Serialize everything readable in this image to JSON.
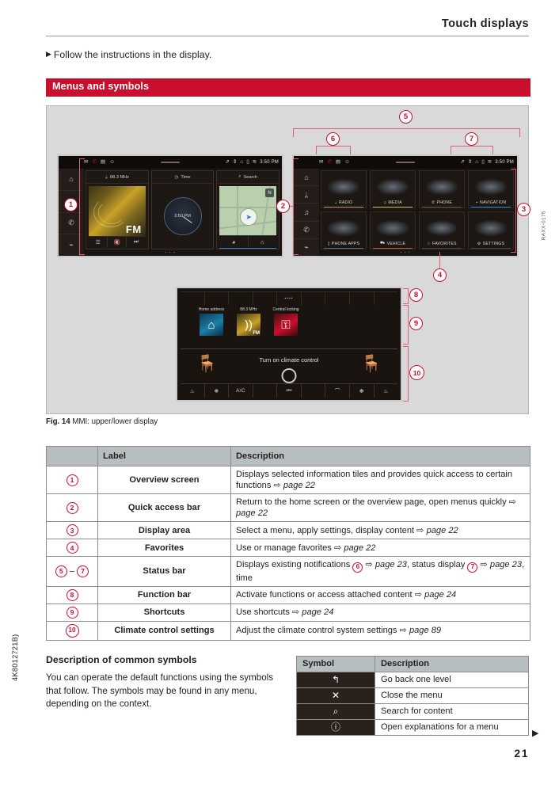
{
  "header": {
    "running_head": "Touch displays"
  },
  "intro": {
    "bullet": "Follow the instructions in the display."
  },
  "section": {
    "title": "Menus and symbols"
  },
  "figure": {
    "caption_label": "Fig. 14",
    "caption_text": "MMI: upper/lower display",
    "image_id": "RAXX-0175"
  },
  "mmi_upper_left": {
    "statusbar": {
      "icons_left": [
        "envelope-icon",
        "phone-icon",
        "card-icon",
        "smiley-icon"
      ],
      "icons_right": [
        "bluetooth-icon",
        "mute-icon",
        "lock-icon",
        "sim-icon",
        "wifi-icon"
      ],
      "time": "3:50 PM"
    },
    "quick_access": [
      "home-icon",
      "radio-icon",
      "phone-icon",
      "navigation-icon"
    ],
    "tiles": [
      {
        "header": "88.3 MHz",
        "header_icon": "radio-icon",
        "art_label": "FM",
        "controls": [
          "list-icon",
          "mute-icon",
          "next-icon"
        ]
      },
      {
        "header": "Time",
        "header_icon": "clock-icon",
        "clock_value": "3:50 PM"
      },
      {
        "header": "Search",
        "header_icon": "search-icon",
        "compass": "N",
        "controls": [
          "recent-icon",
          "home-icon"
        ]
      }
    ]
  },
  "mmi_upper_right": {
    "statusbar": {
      "icons_left": [
        "envelope-icon",
        "phone-icon",
        "card-icon",
        "smiley-icon"
      ],
      "icons_right": [
        "bluetooth-icon",
        "mute-icon",
        "lock-icon",
        "sim-icon",
        "wifi-icon"
      ],
      "time": "3:50 PM"
    },
    "quick_access": [
      "home-icon",
      "radio-icon",
      "media-icon",
      "phone-icon",
      "navigation-icon"
    ],
    "menu_tiles": [
      {
        "label": "RADIO",
        "icon": "antenna-icon",
        "accent": "#c08a3e"
      },
      {
        "label": "MEDIA",
        "icon": "note-icon",
        "accent": "#c8b24a"
      },
      {
        "label": "PHONE",
        "icon": "handset-icon",
        "accent": "#5e5148"
      },
      {
        "label": "NAVIGATION",
        "icon": "arrow-icon",
        "accent": "#2f7fd0"
      },
      {
        "label": "PHONE APPS",
        "icon": "apps-icon",
        "accent": "#4a6f8a"
      },
      {
        "label": "VEHICLE",
        "icon": "car-icon",
        "accent": "#b4601f"
      },
      {
        "label": "FAVORITES",
        "icon": "star-icon",
        "accent": "#3a4550"
      },
      {
        "label": "SETTINGS",
        "icon": "gear-icon",
        "accent": "#3a4550"
      }
    ]
  },
  "mmi_lower": {
    "function_bar_slots": [
      "",
      "",
      "",
      "",
      "menu-handle-icon",
      "",
      "",
      "",
      ""
    ],
    "shortcuts": [
      {
        "label": "Home address",
        "icon": "house-icon"
      },
      {
        "label": "88.3 MHz",
        "icon": "radio-waves-icon",
        "sub": "FM"
      },
      {
        "label": "Central locking",
        "icon": "key-lock-icon"
      }
    ],
    "climate": {
      "message": "Turn on climate control",
      "knob": "rotary-knob-icon",
      "seat_left": "seat-icon",
      "seat_right": "seat-icon"
    },
    "bottom_bar": [
      "seat-heat-icon",
      "seat-climate-icon",
      "A/C",
      "",
      "…",
      "",
      "defrost-icon",
      "seat-vent-icon",
      "seat-heat-rear-icon"
    ]
  },
  "callouts": [
    "1",
    "2",
    "3",
    "4",
    "5",
    "6",
    "7",
    "8",
    "9",
    "10"
  ],
  "table": {
    "headers": [
      "",
      "Label",
      "Description"
    ],
    "rows": [
      {
        "num": "1",
        "label": "Overview screen",
        "desc_pre": "Displays selected information tiles and provides quick access to certain functions ",
        "ref": "page 22",
        "desc_post": ""
      },
      {
        "num": "2",
        "label": "Quick access bar",
        "desc_pre": "Return to the home screen or the overview page, open menus quickly ",
        "ref": "page 22",
        "desc_post": ""
      },
      {
        "num": "3",
        "label": "Display area",
        "desc_pre": "Select a menu, apply settings, display content ",
        "ref": "page 22",
        "desc_post": ""
      },
      {
        "num": "4",
        "label": "Favorites",
        "desc_pre": "Use or manage favorites ",
        "ref": "page 22",
        "desc_post": ""
      },
      {
        "num": "5 – 7",
        "label": "Status bar",
        "desc_pre": "Displays existing notifications ",
        "ref": "page 23",
        "desc_post": ", status display ",
        "ref2": "page 23",
        "desc_end": ", time",
        "inline_circ_1": "6",
        "inline_circ_2": "7"
      },
      {
        "num": "8",
        "label": "Function bar",
        "desc_pre": "Activate functions or access attached content ",
        "ref": "page 24",
        "desc_post": ""
      },
      {
        "num": "9",
        "label": "Shortcuts",
        "desc_pre": "Use shortcuts ",
        "ref": "page 24",
        "desc_post": ""
      },
      {
        "num": "10",
        "label": "Climate control settings",
        "desc_pre": "Adjust the climate control system settings ",
        "ref": "page 89",
        "desc_post": ""
      }
    ]
  },
  "symbols_section": {
    "heading": "Description of common symbols",
    "paragraph": "You can operate the default functions using the symbols that follow. The symbols may be found in any menu, depending on the context.",
    "table_headers": [
      "Symbol",
      "Description"
    ],
    "rows": [
      {
        "symbol": "back-arrow-icon",
        "glyph": "↰",
        "desc": "Go back one level"
      },
      {
        "symbol": "close-icon",
        "glyph": "✕",
        "desc": "Close the menu"
      },
      {
        "symbol": "search-icon",
        "glyph": "⌕",
        "desc": "Search for content"
      },
      {
        "symbol": "info-icon",
        "glyph": "ⓘ",
        "desc": "Open explanations for a menu"
      }
    ],
    "continue_marker": "▶"
  },
  "footer": {
    "side_code": "4K8012721B)",
    "page_number": "21"
  },
  "colors": {
    "accent_red": "#c8102e",
    "table_header": "#b7bec0",
    "figure_bg": "#d9d9d9"
  }
}
